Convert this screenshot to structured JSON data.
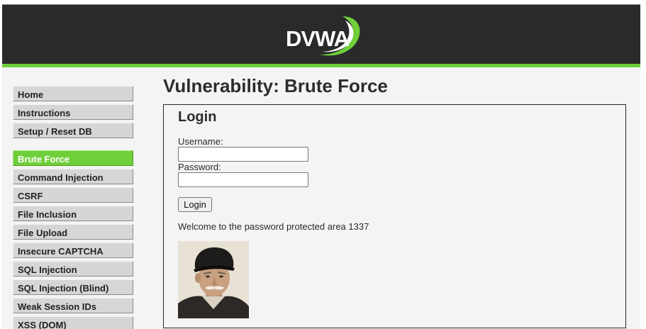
{
  "header": {
    "logo_text": "DVWA",
    "brand_color": "#6fcf3a",
    "background_color": "#2a2a2a"
  },
  "sidebar": {
    "groups": [
      {
        "items": [
          {
            "label": "Home",
            "selected": false
          },
          {
            "label": "Instructions",
            "selected": false
          },
          {
            "label": "Setup / Reset DB",
            "selected": false
          }
        ]
      },
      {
        "items": [
          {
            "label": "Brute Force",
            "selected": true
          },
          {
            "label": "Command Injection",
            "selected": false
          },
          {
            "label": "CSRF",
            "selected": false
          },
          {
            "label": "File Inclusion",
            "selected": false
          },
          {
            "label": "File Upload",
            "selected": false
          },
          {
            "label": "Insecure CAPTCHA",
            "selected": false
          },
          {
            "label": "SQL Injection",
            "selected": false
          },
          {
            "label": "SQL Injection (Blind)",
            "selected": false
          },
          {
            "label": "Weak Session IDs",
            "selected": false
          },
          {
            "label": "XSS (DOM)",
            "selected": false
          }
        ]
      }
    ]
  },
  "main": {
    "title": "Vulnerability: Brute Force",
    "login": {
      "heading": "Login",
      "username_label": "Username:",
      "username_value": "",
      "password_label": "Password:",
      "password_value": "",
      "button_label": "Login",
      "welcome_message": "Welcome to the password protected area 1337",
      "avatar_icon": "user-photo-elderly-man-cap"
    }
  }
}
